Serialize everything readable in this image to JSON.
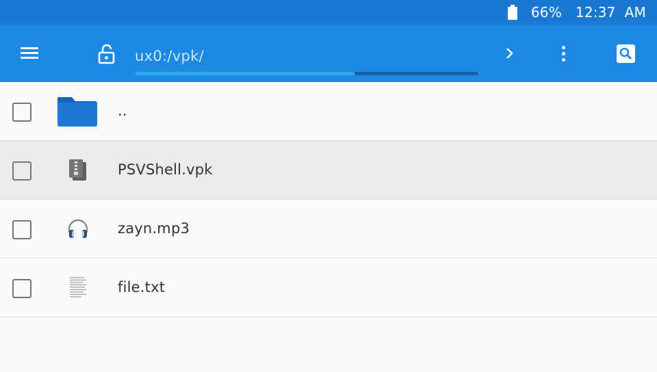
{
  "status": {
    "battery_icon": "battery-icon",
    "battery_percent": "66%",
    "time": "12:37  AM"
  },
  "toolbar": {
    "menu_icon": "menu-icon",
    "lock_icon": "unlocked-padlock-icon",
    "path": "ux0:/vpk/",
    "path_progress": 0.64,
    "forward_icon": "chevron-right-icon",
    "more_icon": "more-vert-icon",
    "search_icon": "search-icon",
    "background": "#1e88e5",
    "statusbar_background": "#1a77d2"
  },
  "files": [
    {
      "name": "..",
      "type": "folder",
      "icon": "folder-icon",
      "selected": false
    },
    {
      "name": "PSVShell.vpk",
      "type": "archive",
      "icon": "archive-icon",
      "selected": true
    },
    {
      "name": "zayn.mp3",
      "type": "audio",
      "icon": "headphones-icon",
      "selected": false
    },
    {
      "name": "file.txt",
      "type": "text",
      "icon": "text-file-icon",
      "selected": false
    }
  ]
}
